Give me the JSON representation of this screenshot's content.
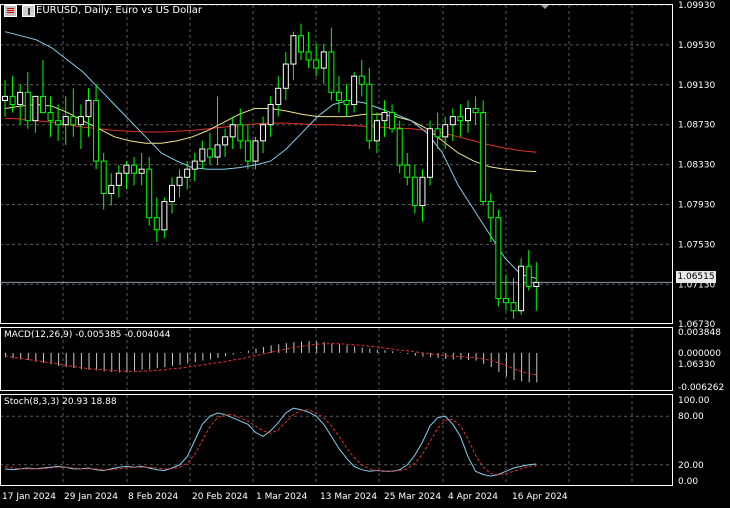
{
  "header": {
    "symbol_title": "EURUSD, Daily:  Euro vs US Dollar"
  },
  "colors": {
    "background": "#000000",
    "grid": "#5a5a5a",
    "candle_up": "#ffffff",
    "candle_down_wick": "#00ff00",
    "ma_fast": "#87ceeb",
    "ma_mid": "#f0e68c",
    "ma_slow": "#e0302a",
    "macd_hist": "#c8c8c8",
    "macd_signal": "#e03030",
    "stoch_main": "#87ceeb",
    "stoch_signal": "#e03030",
    "price_line": "#8899aa"
  },
  "main_axis": {
    "ticks": [
      "1.09930",
      "1.09530",
      "1.09130",
      "1.08730",
      "1.08330",
      "1.07930",
      "1.07530",
      "1.07130",
      "1.06730",
      "1.06330"
    ],
    "current_price": "1.06515"
  },
  "macd_panel": {
    "label": "MACD(12,26,9) -0.005385 -0.004044",
    "ticks": [
      "0.003848",
      "0.000000",
      "-0.006262"
    ]
  },
  "stoch_panel": {
    "label": "Stoch(8,3,3) 20.93 18.88",
    "ticks": [
      "100.00",
      "80.00",
      "20.00",
      "0.00"
    ]
  },
  "time_axis": {
    "labels": [
      "17 Jan 2024",
      "29 Jan 2024",
      "8 Feb 2024",
      "20 Feb 2024",
      "1 Mar 2024",
      "13 Mar 2024",
      "25 Mar 2024",
      "4 Apr 2024",
      "16 Apr 2024"
    ]
  },
  "chart_data": {
    "type": "candlestick",
    "title": "EURUSD, Daily:  Euro vs US Dollar",
    "ylim": [
      1.0606,
      1.0993
    ],
    "candles": [
      {
        "o": 1.0875,
        "h": 1.09,
        "l": 1.0855,
        "c": 1.088
      },
      {
        "o": 1.088,
        "h": 1.0905,
        "l": 1.086,
        "c": 1.087
      },
      {
        "o": 1.087,
        "h": 1.0895,
        "l": 1.0845,
        "c": 1.0885
      },
      {
        "o": 1.0885,
        "h": 1.091,
        "l": 1.084,
        "c": 1.085
      },
      {
        "o": 1.085,
        "h": 1.0875,
        "l": 1.0835,
        "c": 1.088
      },
      {
        "o": 1.088,
        "h": 1.0925,
        "l": 1.086,
        "c": 1.086
      },
      {
        "o": 1.086,
        "h": 1.088,
        "l": 1.083,
        "c": 1.085
      },
      {
        "o": 1.085,
        "h": 1.087,
        "l": 1.0825,
        "c": 1.0845
      },
      {
        "o": 1.0845,
        "h": 1.088,
        "l": 1.082,
        "c": 1.0855
      },
      {
        "o": 1.0855,
        "h": 1.089,
        "l": 1.083,
        "c": 1.0845
      },
      {
        "o": 1.0845,
        "h": 1.087,
        "l": 1.0815,
        "c": 1.0855
      },
      {
        "o": 1.0855,
        "h": 1.089,
        "l": 1.083,
        "c": 1.0875
      },
      {
        "o": 1.0875,
        "h": 1.0895,
        "l": 1.079,
        "c": 1.08
      },
      {
        "o": 1.08,
        "h": 1.081,
        "l": 1.074,
        "c": 1.076
      },
      {
        "o": 1.076,
        "h": 1.0785,
        "l": 1.0745,
        "c": 1.077
      },
      {
        "o": 1.077,
        "h": 1.0795,
        "l": 1.0755,
        "c": 1.0785
      },
      {
        "o": 1.0785,
        "h": 1.08,
        "l": 1.0765,
        "c": 1.0795
      },
      {
        "o": 1.0795,
        "h": 1.0805,
        "l": 1.077,
        "c": 1.0785
      },
      {
        "o": 1.0785,
        "h": 1.081,
        "l": 1.077,
        "c": 1.079
      },
      {
        "o": 1.079,
        "h": 1.0805,
        "l": 1.072,
        "c": 1.073
      },
      {
        "o": 1.073,
        "h": 1.0755,
        "l": 1.07,
        "c": 1.0715
      },
      {
        "o": 1.0715,
        "h": 1.0755,
        "l": 1.0705,
        "c": 1.075
      },
      {
        "o": 1.075,
        "h": 1.078,
        "l": 1.0735,
        "c": 1.077
      },
      {
        "o": 1.077,
        "h": 1.079,
        "l": 1.0755,
        "c": 1.078
      },
      {
        "o": 1.078,
        "h": 1.08,
        "l": 1.0765,
        "c": 1.079
      },
      {
        "o": 1.079,
        "h": 1.081,
        "l": 1.0775,
        "c": 1.08
      },
      {
        "o": 1.08,
        "h": 1.0825,
        "l": 1.079,
        "c": 1.0815
      },
      {
        "o": 1.0815,
        "h": 1.0835,
        "l": 1.0795,
        "c": 1.0805
      },
      {
        "o": 1.0805,
        "h": 1.088,
        "l": 1.0795,
        "c": 1.082
      },
      {
        "o": 1.082,
        "h": 1.084,
        "l": 1.0805,
        "c": 1.083
      },
      {
        "o": 1.083,
        "h": 1.0855,
        "l": 1.0815,
        "c": 1.0845
      },
      {
        "o": 1.0845,
        "h": 1.0865,
        "l": 1.0815,
        "c": 1.0825
      },
      {
        "o": 1.0825,
        "h": 1.0845,
        "l": 1.079,
        "c": 1.08
      },
      {
        "o": 1.08,
        "h": 1.083,
        "l": 1.079,
        "c": 1.0825
      },
      {
        "o": 1.0825,
        "h": 1.0855,
        "l": 1.081,
        "c": 1.0845
      },
      {
        "o": 1.0845,
        "h": 1.088,
        "l": 1.083,
        "c": 1.087
      },
      {
        "o": 1.087,
        "h": 1.0905,
        "l": 1.0855,
        "c": 1.089
      },
      {
        "o": 1.089,
        "h": 1.0935,
        "l": 1.0875,
        "c": 1.092
      },
      {
        "o": 1.092,
        "h": 1.096,
        "l": 1.09,
        "c": 1.0955
      },
      {
        "o": 1.0955,
        "h": 1.097,
        "l": 1.0925,
        "c": 1.0935
      },
      {
        "o": 1.0935,
        "h": 1.096,
        "l": 1.0915,
        "c": 1.0925
      },
      {
        "o": 1.0925,
        "h": 1.0945,
        "l": 1.0905,
        "c": 1.0915
      },
      {
        "o": 1.0915,
        "h": 1.0945,
        "l": 1.0895,
        "c": 1.0935
      },
      {
        "o": 1.0935,
        "h": 1.0965,
        "l": 1.0875,
        "c": 1.0885
      },
      {
        "o": 1.0885,
        "h": 1.0905,
        "l": 1.086,
        "c": 1.0875
      },
      {
        "o": 1.0875,
        "h": 1.0895,
        "l": 1.0855,
        "c": 1.087
      },
      {
        "o": 1.087,
        "h": 1.091,
        "l": 1.086,
        "c": 1.0905
      },
      {
        "o": 1.0905,
        "h": 1.0925,
        "l": 1.088,
        "c": 1.0895
      },
      {
        "o": 1.0895,
        "h": 1.0915,
        "l": 1.0815,
        "c": 1.0825
      },
      {
        "o": 1.0825,
        "h": 1.086,
        "l": 1.081,
        "c": 1.085
      },
      {
        "o": 1.085,
        "h": 1.0875,
        "l": 1.083,
        "c": 1.086
      },
      {
        "o": 1.086,
        "h": 1.087,
        "l": 1.0835,
        "c": 1.084
      },
      {
        "o": 1.084,
        "h": 1.085,
        "l": 1.0785,
        "c": 1.0795
      },
      {
        "o": 1.0795,
        "h": 1.081,
        "l": 1.077,
        "c": 1.078
      },
      {
        "o": 1.078,
        "h": 1.0795,
        "l": 1.0735,
        "c": 1.0745
      },
      {
        "o": 1.0745,
        "h": 1.079,
        "l": 1.0725,
        "c": 1.078
      },
      {
        "o": 1.078,
        "h": 1.085,
        "l": 1.077,
        "c": 1.084
      },
      {
        "o": 1.084,
        "h": 1.086,
        "l": 1.0815,
        "c": 1.083
      },
      {
        "o": 1.083,
        "h": 1.0855,
        "l": 1.0815,
        "c": 1.0845
      },
      {
        "o": 1.0845,
        "h": 1.0865,
        "l": 1.0825,
        "c": 1.0855
      },
      {
        "o": 1.0855,
        "h": 1.087,
        "l": 1.083,
        "c": 1.085
      },
      {
        "o": 1.085,
        "h": 1.0875,
        "l": 1.0835,
        "c": 1.0865
      },
      {
        "o": 1.0865,
        "h": 1.088,
        "l": 1.0845,
        "c": 1.086
      },
      {
        "o": 1.086,
        "h": 1.0875,
        "l": 1.0745,
        "c": 1.075
      },
      {
        "o": 1.075,
        "h": 1.076,
        "l": 1.07,
        "c": 1.073
      },
      {
        "o": 1.073,
        "h": 1.074,
        "l": 1.062,
        "c": 1.063
      },
      {
        "o": 1.063,
        "h": 1.066,
        "l": 1.0615,
        "c": 1.0625
      },
      {
        "o": 1.0625,
        "h": 1.0655,
        "l": 1.0605,
        "c": 1.0615
      },
      {
        "o": 1.0615,
        "h": 1.068,
        "l": 1.061,
        "c": 1.067
      },
      {
        "o": 1.067,
        "h": 1.069,
        "l": 1.064,
        "c": 1.0645
      },
      {
        "o": 1.0645,
        "h": 1.0675,
        "l": 1.0615,
        "c": 1.065
      }
    ],
    "ma_fast": [
      1.096,
      1.0955,
      1.095,
      1.094,
      1.0925,
      1.091,
      1.089,
      1.087,
      1.085,
      1.083,
      1.081,
      1.08,
      1.0792,
      1.079,
      1.079,
      1.0792,
      1.0795,
      1.08,
      1.0815,
      1.0835,
      1.0855,
      1.087,
      1.0875,
      1.0872,
      1.0865,
      1.0858,
      1.085,
      1.0835,
      1.081,
      1.077,
      1.074,
      1.071,
      1.068,
      1.066,
      1.0655
    ],
    "ma_mid": [
      1.0865,
      1.0868,
      1.087,
      1.0868,
      1.086,
      1.085,
      1.084,
      1.083,
      1.0825,
      1.0822,
      1.0822,
      1.0825,
      1.083,
      1.0838,
      1.0848,
      1.0858,
      1.0865,
      1.0865,
      1.0862,
      1.0858,
      1.0855,
      1.0855,
      1.0855,
      1.0858,
      1.0858,
      1.0855,
      1.085,
      1.084,
      1.0825,
      1.081,
      1.08,
      1.0793,
      1.079,
      1.0788,
      1.0787
    ],
    "ma_slow": [
      1.0853,
      1.0852,
      1.085,
      1.0848,
      1.0845,
      1.0842,
      1.084,
      1.0838,
      1.0837,
      1.0836,
      1.0836,
      1.0837,
      1.0838,
      1.084,
      1.0842,
      1.0844,
      1.0846,
      1.0847,
      1.0847,
      1.0846,
      1.0845,
      1.0845,
      1.0844,
      1.0843,
      1.0842,
      1.0841,
      1.084,
      1.0838,
      1.0835,
      1.083,
      1.0825,
      1.082,
      1.0816,
      1.0813,
      1.0811
    ],
    "macd_ylim": [
      -0.006262,
      0.003848
    ],
    "macd_hist": [
      -0.0008,
      -0.001,
      -0.0012,
      -0.0013,
      -0.0016,
      -0.0018,
      -0.0021,
      -0.0024,
      -0.0026,
      -0.0028,
      -0.003,
      -0.0031,
      -0.0032,
      -0.0034,
      -0.0035,
      -0.0036,
      -0.0035,
      -0.0033,
      -0.0031,
      -0.003,
      -0.0028,
      -0.0026,
      -0.0024,
      -0.0022,
      -0.0019,
      -0.0017,
      -0.0014,
      -0.0012,
      -0.0009,
      -0.0006,
      -0.0003,
      0.0001,
      0.0004,
      0.0008,
      0.0011,
      0.0014,
      0.0016,
      0.0018,
      0.002,
      0.0021,
      0.0022,
      0.0021,
      0.002,
      0.0018,
      0.0016,
      0.0014,
      0.0012,
      0.001,
      0.0008,
      0.0006,
      0.0005,
      0.0003,
      0.0001,
      -0.0002,
      -0.0005,
      -0.0007,
      -0.0008,
      -0.0009,
      -0.0011,
      -0.0012,
      -0.0012,
      -0.0013,
      -0.0014,
      -0.002,
      -0.0026,
      -0.0035,
      -0.0043,
      -0.005,
      -0.0052,
      -0.0054,
      -0.0054
    ],
    "macd_signal": [
      -0.0005,
      -0.0008,
      -0.001,
      -0.0012,
      -0.0014,
      -0.0016,
      -0.0018,
      -0.002,
      -0.0023,
      -0.0025,
      -0.0027,
      -0.0029,
      -0.003,
      -0.0031,
      -0.0032,
      -0.0033,
      -0.0034,
      -0.0034,
      -0.0034,
      -0.0033,
      -0.0032,
      -0.0031,
      -0.0029,
      -0.0028,
      -0.0026,
      -0.0024,
      -0.0022,
      -0.002,
      -0.0018,
      -0.0016,
      -0.0013,
      -0.0011,
      -0.0008,
      -0.0005,
      -0.0002,
      0.0001,
      0.0004,
      0.0007,
      0.001,
      0.0012,
      0.0014,
      0.0016,
      0.0017,
      0.0017,
      0.0017,
      0.0016,
      0.0015,
      0.0014,
      0.0012,
      0.0011,
      0.0009,
      0.0007,
      0.0005,
      0.0004,
      0.0002,
      0.0,
      -0.0002,
      -0.0003,
      -0.0005,
      -0.0006,
      -0.0007,
      -0.0008,
      -0.0009,
      -0.0011,
      -0.0014,
      -0.0018,
      -0.0023,
      -0.0029,
      -0.0034,
      -0.0038,
      -0.004
    ],
    "stoch_main": [
      15,
      14,
      15,
      16,
      15,
      16,
      17,
      18,
      17,
      15,
      15,
      16,
      14,
      13,
      15,
      17,
      18,
      17,
      18,
      16,
      14,
      13,
      16,
      20,
      30,
      50,
      70,
      80,
      84,
      82,
      78,
      74,
      70,
      60,
      55,
      62,
      72,
      84,
      90,
      88,
      85,
      80,
      70,
      55,
      40,
      28,
      18,
      14,
      12,
      13,
      12,
      12,
      14,
      20,
      32,
      48,
      68,
      78,
      80,
      70,
      55,
      30,
      12,
      8,
      6,
      8,
      12,
      16,
      18,
      20,
      21
    ],
    "stoch_signal": [
      18,
      16,
      15,
      15,
      15,
      15,
      16,
      17,
      17,
      16,
      15,
      15,
      15,
      14,
      14,
      15,
      16,
      17,
      17,
      17,
      16,
      15,
      15,
      17,
      22,
      33,
      50,
      67,
      78,
      82,
      82,
      78,
      74,
      68,
      62,
      59,
      63,
      73,
      82,
      87,
      88,
      84,
      78,
      68,
      55,
      41,
      29,
      20,
      15,
      13,
      12,
      12,
      13,
      15,
      22,
      33,
      49,
      65,
      75,
      76,
      68,
      52,
      32,
      17,
      9,
      8,
      9,
      12,
      15,
      18,
      19
    ]
  }
}
